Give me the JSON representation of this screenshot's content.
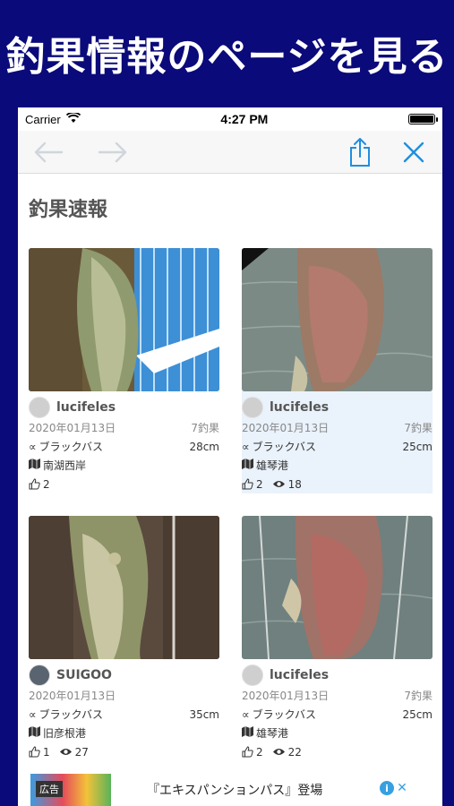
{
  "banner": {
    "text": "釣果情報のページを見る"
  },
  "status_bar": {
    "carrier": "Carrier",
    "time": "4:27 PM"
  },
  "toolbar": {
    "back_icon": "arrow-left-icon",
    "forward_icon": "arrow-right-icon",
    "share_icon": "share-icon",
    "close_icon": "close-icon",
    "accent_color": "#1e8fe0"
  },
  "page": {
    "section_title": "釣果速報"
  },
  "cards": [
    {
      "user": "lucifeles",
      "date": "2020年01月13日",
      "catch_no": "7釣果",
      "species": "ブラックバス",
      "size": "28cm",
      "place": "南湖西岸",
      "likes": "2",
      "views": ""
    },
    {
      "user": "lucifeles",
      "date": "2020年01月13日",
      "catch_no": "7釣果",
      "species": "ブラックバス",
      "size": "25cm",
      "place": "雄琴港",
      "likes": "2",
      "views": "18"
    },
    {
      "user": "SUIGOO",
      "date": "2020年01月13日",
      "catch_no": "",
      "species": "ブラックバス",
      "size": "35cm",
      "place": "旧彦根港",
      "likes": "1",
      "views": "27"
    },
    {
      "user": "lucifeles",
      "date": "2020年01月13日",
      "catch_no": "7釣果",
      "species": "ブラックバス",
      "size": "25cm",
      "place": "雄琴港",
      "likes": "2",
      "views": "22"
    }
  ],
  "ad": {
    "label": "広告",
    "text": "『エキスパンションパス』登場"
  }
}
